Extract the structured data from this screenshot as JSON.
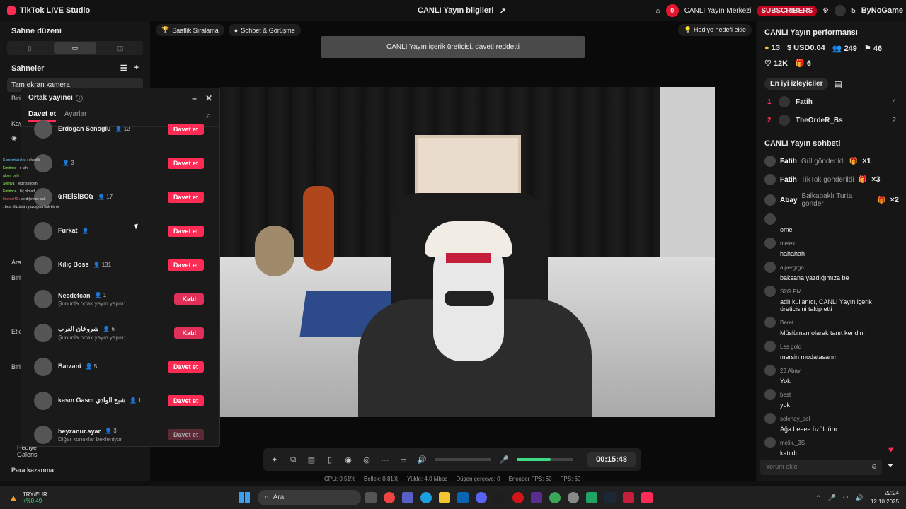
{
  "app": {
    "title": "TikTok LIVE Studio",
    "center_title": "CANLI Yayın bilgileri"
  },
  "top_right": {
    "notif_count": "0",
    "live_center": "CANLI Yayın Merkezi",
    "subscribers": "SUBSCRIBERS",
    "count": "5",
    "brand": "ByNoGame"
  },
  "sidebar": {
    "scene_layout": "Sahne düzeni",
    "scenes_label": "Sahneler",
    "scene_item": "Tam ekran kamera",
    "labels": [
      "Biri",
      "Kay",
      "Ara",
      "Birli",
      "Etk",
      "Birl",
      "Hediye Galerisi",
      "Para kazanma"
    ]
  },
  "chips": {
    "hourly": "Saatlik Sıralama",
    "chat": "Sohbet & Görüşme",
    "gift_goal": "Hediye hedefi ekle"
  },
  "toast": "CANLI Yayın içerik üreticisi, daveti reddetti",
  "panel": {
    "title": "Ortak yayıncı",
    "tab_invite": "Davet et",
    "tab_settings": "Ayarlar",
    "hosts": [
      {
        "name": "Erdogan Senoglu",
        "count": "12",
        "action": "Davet et",
        "kind": "invite",
        "sub": ""
      },
      {
        "name": "",
        "count": "3",
        "action": "Davet et",
        "kind": "invite",
        "sub": ""
      },
      {
        "name": "ҨREİSİBOҨ",
        "count": "17",
        "action": "Davet et",
        "kind": "invite",
        "sub": ""
      },
      {
        "name": "Furkat",
        "count": "",
        "action": "Davet et",
        "kind": "invite",
        "sub": ""
      },
      {
        "name": "Kılıç Boss",
        "count": "131",
        "action": "Davet et",
        "kind": "invite",
        "sub": ""
      },
      {
        "name": "Necdetcan",
        "count": "1",
        "action": "Katıl",
        "kind": "join",
        "sub": "Şununla ortak yayın yapın:"
      },
      {
        "name": "شروخان العرب",
        "count": "6",
        "action": "Katıl",
        "kind": "join",
        "sub": "Şununla ortak yayın yapın:"
      },
      {
        "name": "Barzani",
        "count": "5",
        "action": "Davet et",
        "kind": "invite",
        "sub": ""
      },
      {
        "name": "kasm Gasm شبح الوادي",
        "count": "1",
        "action": "Davet et",
        "kind": "invite",
        "sub": ""
      },
      {
        "name": "beyzanur.ayar",
        "count": "3",
        "action": "Davet et",
        "kind": "dim",
        "sub": "Diğer konuklar bekleniyor"
      }
    ]
  },
  "overlay_chat": [
    {
      "user": "Kemerrtubeles",
      "text": "ekledik"
    },
    {
      "user": "Emirince",
      "text": "o tah"
    },
    {
      "user": "alper_only",
      "text": ""
    },
    {
      "user": "Sellnya",
      "text": "iyidir senden"
    },
    {
      "user": "Emirince",
      "text": "hiç olmadı"
    },
    {
      "user": "Imenisi40",
      "text": "verdiğimize bak"
    },
    {
      "user": "",
      "text": "best ölüzünün yazdığına bak bir de"
    }
  ],
  "toolbar": {
    "timer": "00:15:48"
  },
  "stats": {
    "cpu": "CPU: 0.51%",
    "mem": "Bellek: 0.81%",
    "upload": "Yükle: 4.0 Mbps",
    "dropped": "Düşen çerçeve: 0",
    "encoder": "Encoder FPS: 60",
    "fps": "FPS: 60"
  },
  "performance": {
    "title": "CANLI Yayın performansı",
    "coins": "13",
    "usd": "USD0.04",
    "viewers": "249",
    "shares": "46",
    "likes": "12K",
    "gifts": "6",
    "top_viewers_label": "En iyi izleyiciler",
    "top_viewers": [
      {
        "rank": "1",
        "name": "Fatih",
        "count": "4"
      },
      {
        "rank": "2",
        "name": "TheOrdeR_Bs",
        "count": "2"
      }
    ]
  },
  "chat": {
    "title": "CANLI Yayın sohbeti",
    "gifts": [
      {
        "user": "Fatih",
        "text": "Gül gönderildi",
        "mult": "×1"
      },
      {
        "user": "Fatih",
        "text": "TikTok gönderildi",
        "mult": "×3"
      },
      {
        "user": "Abay",
        "text": "Balkabaklı Turta gönder",
        "mult": "×2"
      }
    ],
    "messages": [
      {
        "user": "",
        "text": "ome"
      },
      {
        "user": "melek",
        "text": "hahahah"
      },
      {
        "user": "alpergrgn",
        "text": "baksana yazdığımıza be"
      },
      {
        "user": "S2G PM",
        "text": "adlı kullanıcı, CANLI Yayın içerik üreticisini takip etti"
      },
      {
        "user": "Berat",
        "text": "Müslüman olarak tanıt kendini"
      },
      {
        "user": "Les gold",
        "text": "mersin modatasanm"
      },
      {
        "user": "23 Abay",
        "text": "Yok"
      },
      {
        "user": "best",
        "text": "yok"
      },
      {
        "user": "selenay_sel",
        "text": "Ağa beeee üzüldüm"
      },
      {
        "user": "melik._3S",
        "text": "katıldı"
      }
    ],
    "placeholder": "Yorum ekle"
  },
  "taskbar": {
    "ticker": "TRY/EUR",
    "change": "+%0,49",
    "search": "Ara",
    "time": "22:24",
    "date": "12.10.2025"
  }
}
